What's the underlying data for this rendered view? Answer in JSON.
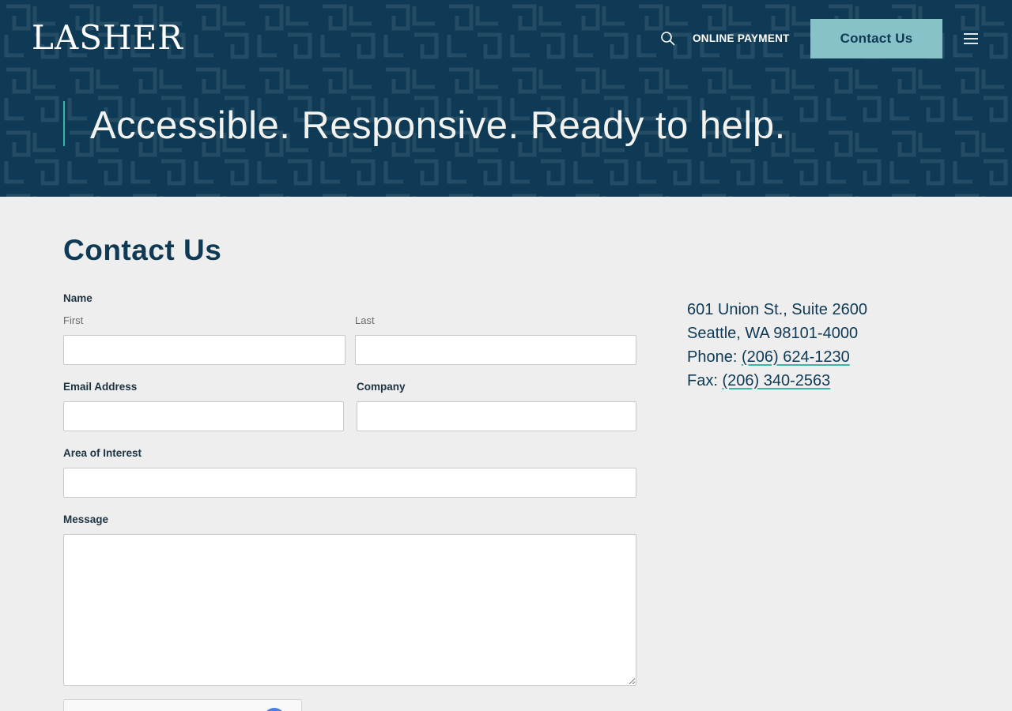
{
  "header": {
    "logo": "LASHER",
    "online_payment": "ONLINE PAYMENT",
    "contact_button": "Contact Us",
    "search_icon": "search-icon",
    "menu_icon": "hamburger-menu-icon"
  },
  "hero": {
    "tagline": "Accessible. Responsive. Ready to help."
  },
  "colors": {
    "navy": "#0e3a55",
    "teal_button": "#86c2c8",
    "accent": "#38b6a6",
    "background": "#eeeeee"
  },
  "form": {
    "title": "Contact Us",
    "name_label": "Name",
    "first_label": "First",
    "last_label": "Last",
    "email_label": "Email Address",
    "company_label": "Company",
    "interest_label": "Area of Interest",
    "message_label": "Message",
    "first_value": "",
    "last_value": "",
    "email_value": "",
    "company_value": "",
    "interest_value": "",
    "message_value": ""
  },
  "address": {
    "line1": "601 Union St., Suite 2600",
    "line2": "Seattle, WA 98101-4000",
    "phone_label": "Phone: ",
    "phone": "(206) 624-1230",
    "fax_label": "Fax: ",
    "fax": "(206) 340-2563"
  }
}
